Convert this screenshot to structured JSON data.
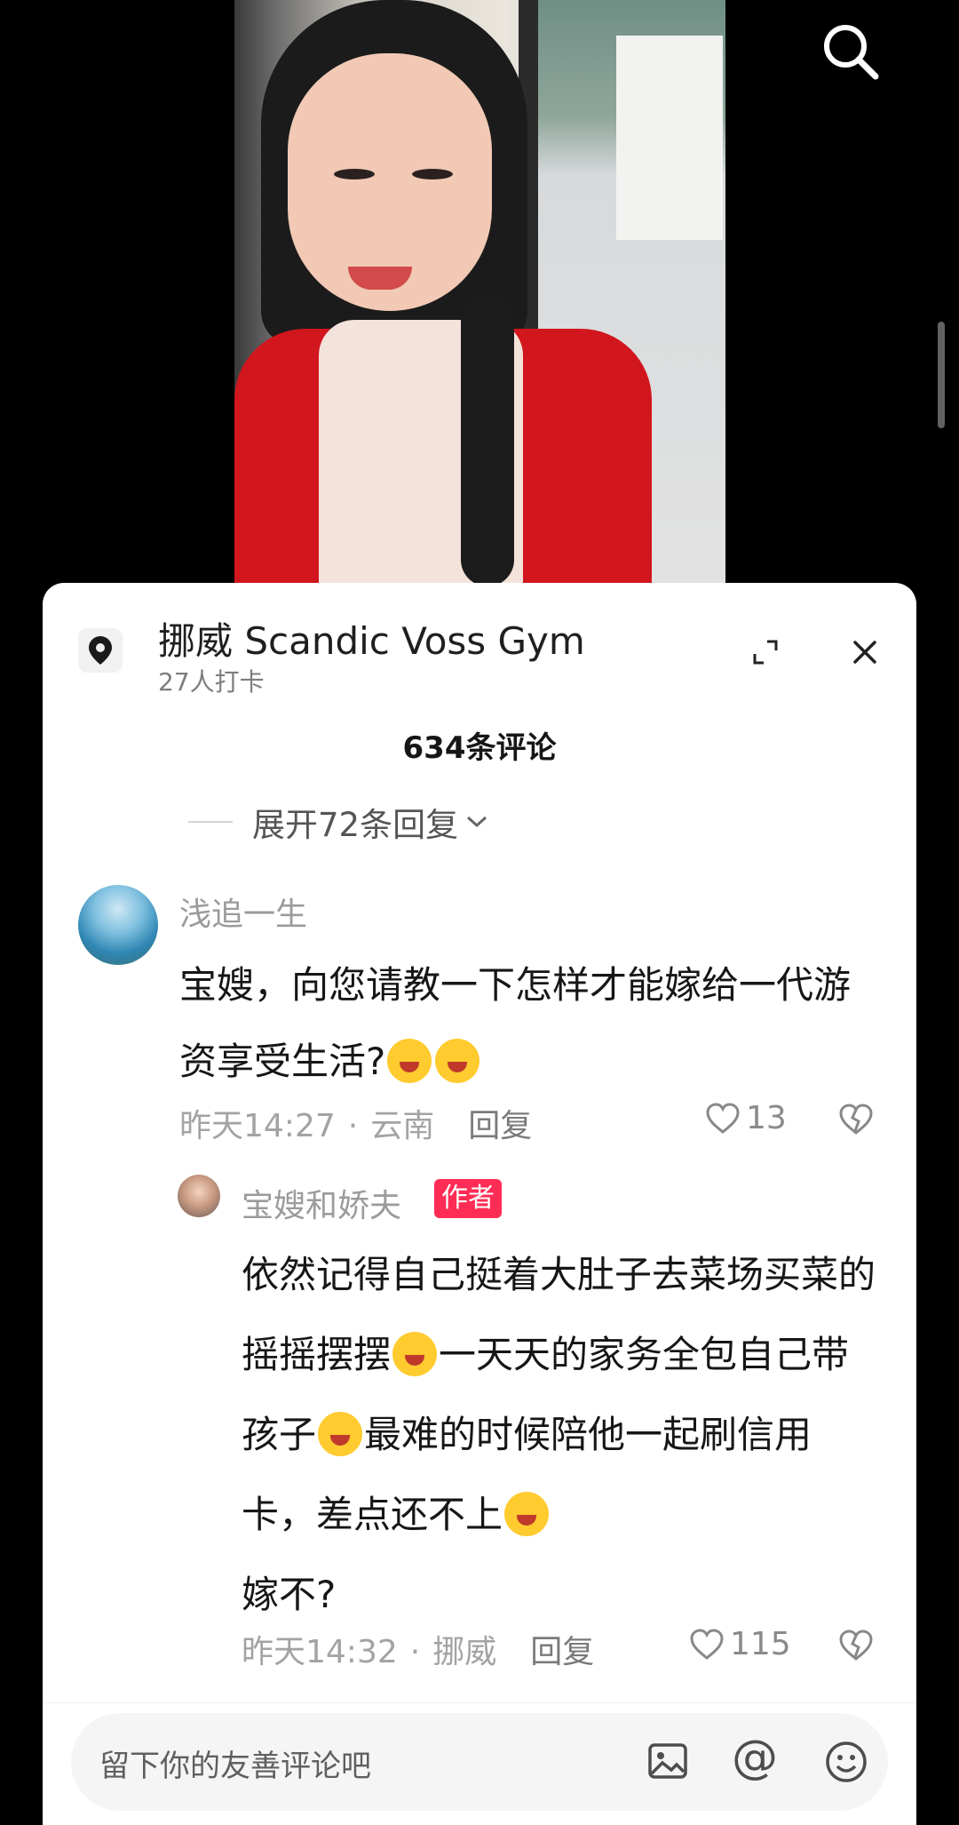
{
  "location": {
    "title": "挪威 Scandic Voss Gym",
    "checkins": "27人打卡"
  },
  "comments_header": {
    "count": "634条评论",
    "expand_replies": "展开72条回复"
  },
  "comments": [
    {
      "username": "浅追一生",
      "text": "宝嫂，向您请教一下怎样才能嫁给一代游资享受生活?",
      "emoji_count": 2,
      "time": "昨天14:27",
      "region": "云南",
      "reply_label": "回复",
      "likes": "13"
    },
    {
      "username": "宝嫂和娇夫",
      "badge": "作者",
      "text_parts": [
        "依然记得自己挺着大肚子去菜场买菜的摇摇摆摆",
        "一天天的家务全包自己带孩子",
        "最难的时候陪他一起刷信用卡，差点还不上",
        "嫁不?"
      ],
      "time": "昨天14:32",
      "region": "挪威",
      "reply_label": "回复",
      "likes": "115"
    }
  ],
  "input": {
    "placeholder": "留下你的友善评论吧"
  },
  "colors": {
    "author_badge": "#ff2c55",
    "sheet_bg": "#ffffff",
    "video_bg": "#000000"
  },
  "icons": [
    "search-icon",
    "location-pin-icon",
    "expand-icon",
    "close-icon",
    "chevron-down-icon",
    "heart-icon",
    "dislike-icon",
    "image-icon",
    "at-icon",
    "smile-icon"
  ]
}
